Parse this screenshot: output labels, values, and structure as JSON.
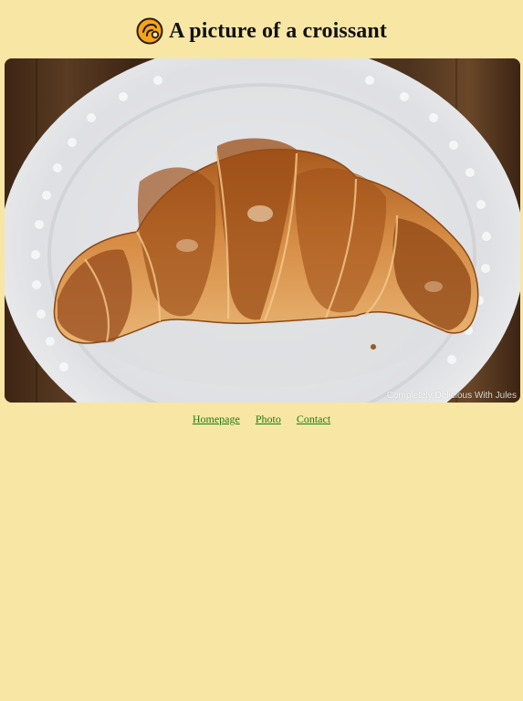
{
  "header": {
    "logo_icon": "croissant-icon",
    "title": "A picture of a croissant"
  },
  "hero": {
    "alt": "A croissant on a white plate",
    "watermark": "Completely Delicious With Jules"
  },
  "nav": {
    "items": [
      {
        "label": "Homepage"
      },
      {
        "label": "Photo"
      },
      {
        "label": "Contact"
      }
    ]
  },
  "colors": {
    "background": "#f8e6a5",
    "link": "#1f7a12",
    "title": "#111111"
  }
}
